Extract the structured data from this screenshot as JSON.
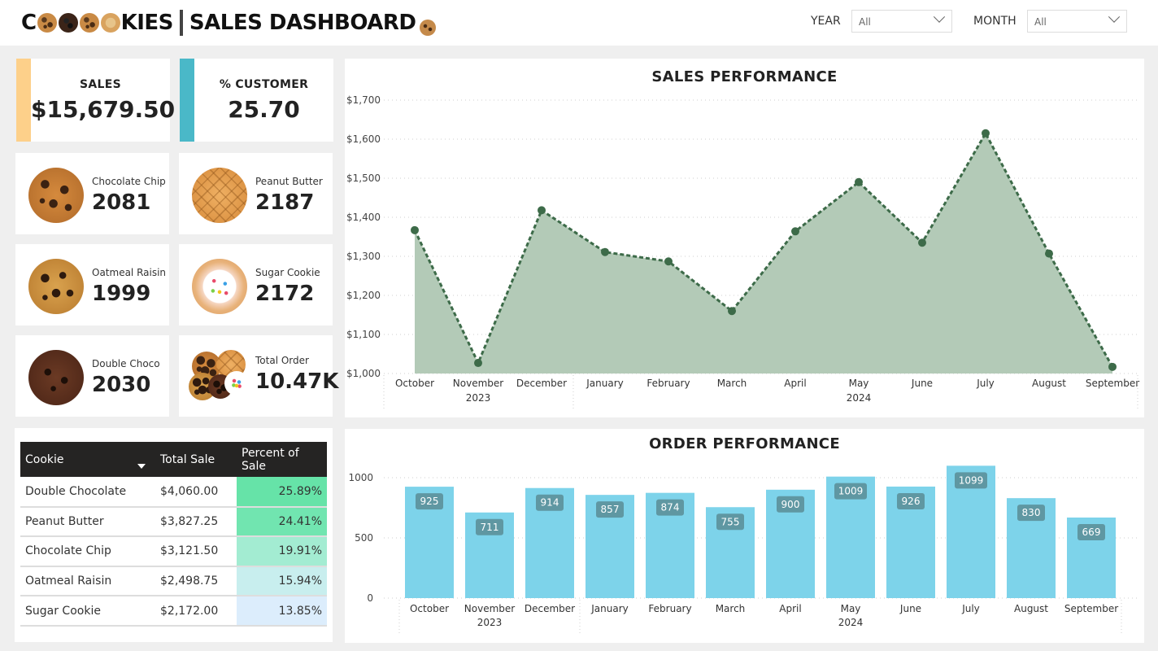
{
  "header": {
    "title_prefix": "C",
    "title_suffix": "KIES",
    "title_main": "SALES DASHBOARD",
    "year_label": "YEAR",
    "year_value": "All",
    "month_label": "MONTH",
    "month_value": "All"
  },
  "kpis": {
    "sales_label": "SALES",
    "sales_value": "$15,679.50",
    "customer_label": "% CUSTOMER",
    "customer_value": "25.70",
    "colors": {
      "sales_accent": "#fdd08a",
      "customer_accent": "#4ab8c8"
    }
  },
  "cookies": [
    {
      "name": "Chocolate Chip",
      "count": "2081",
      "icon": "chocolate-chip-cookie-icon"
    },
    {
      "name": "Peanut Butter",
      "count": "2187",
      "icon": "peanut-butter-cookie-icon"
    },
    {
      "name": "Oatmeal Raisin",
      "count": "1999",
      "icon": "oatmeal-raisin-cookie-icon"
    },
    {
      "name": "Sugar Cookie",
      "count": "2172",
      "icon": "sugar-cookie-icon"
    },
    {
      "name": "Double Choco",
      "count": "2030",
      "icon": "double-choco-cookie-icon"
    },
    {
      "name": "Total Order",
      "count": "10.47K",
      "icon": "cookie-assortment-icon"
    }
  ],
  "table": {
    "headers": [
      "Cookie",
      "Total Sale",
      "Percent of Sale"
    ],
    "rows": [
      {
        "cookie": "Double Chocolate",
        "total": "$4,060.00",
        "pct": "25.89%",
        "color": "#66e3a8"
      },
      {
        "cookie": "Peanut Butter",
        "total": "$3,827.25",
        "pct": "24.41%",
        "color": "#71e5b0"
      },
      {
        "cookie": "Chocolate Chip",
        "total": "$3,121.50",
        "pct": "19.91%",
        "color": "#a3ecd2"
      },
      {
        "cookie": "Oatmeal Raisin",
        "total": "$2,498.75",
        "pct": "15.94%",
        "color": "#c8eeee"
      },
      {
        "cookie": "Sugar Cookie",
        "total": "$2,172.00",
        "pct": "13.85%",
        "color": "#dcedfc"
      }
    ]
  },
  "chart_data": [
    {
      "type": "area",
      "title": "SALES PERFORMANCE",
      "x": [
        "October",
        "November",
        "December",
        "January",
        "February",
        "March",
        "April",
        "May",
        "June",
        "July",
        "August",
        "September"
      ],
      "year_groups": [
        {
          "label": "2023",
          "start": 0,
          "end": 2
        },
        {
          "label": "2024",
          "start": 3,
          "end": 11
        }
      ],
      "values": [
        1367,
        1027,
        1418,
        1311,
        1287,
        1160,
        1364,
        1490,
        1335,
        1615,
        1307,
        1017
      ],
      "ylim": [
        1000,
        1700
      ],
      "yticks": [
        1000,
        1100,
        1200,
        1300,
        1400,
        1500,
        1600,
        1700
      ],
      "ytick_labels": [
        "$1,000",
        "$1,100",
        "$1,200",
        "$1,300",
        "$1,400",
        "$1,500",
        "$1,600",
        "$1,700"
      ],
      "grid": true,
      "colors": {
        "fill": "#b3cab7",
        "line": "#3d6b49"
      }
    },
    {
      "type": "bar",
      "title": "ORDER PERFORMANCE",
      "categories": [
        "October",
        "November",
        "December",
        "January",
        "February",
        "March",
        "April",
        "May",
        "June",
        "July",
        "August",
        "September"
      ],
      "year_groups": [
        {
          "label": "2023",
          "start": 0,
          "end": 2
        },
        {
          "label": "2024",
          "start": 3,
          "end": 11
        }
      ],
      "values": [
        925,
        711,
        914,
        857,
        874,
        755,
        900,
        1009,
        926,
        1099,
        830,
        669
      ],
      "data_labels": [
        "925",
        "711",
        "914",
        "857",
        "874",
        "755",
        "900",
        "1009",
        "926",
        "1099",
        "830",
        "669"
      ],
      "ylim": [
        0,
        1100
      ],
      "yticks": [
        0,
        500,
        1000
      ],
      "ytick_labels": [
        "0",
        "500",
        "1000"
      ],
      "grid": true,
      "colors": {
        "bar": "#7dd3ea",
        "label_bg": "#5f97a2"
      }
    }
  ]
}
